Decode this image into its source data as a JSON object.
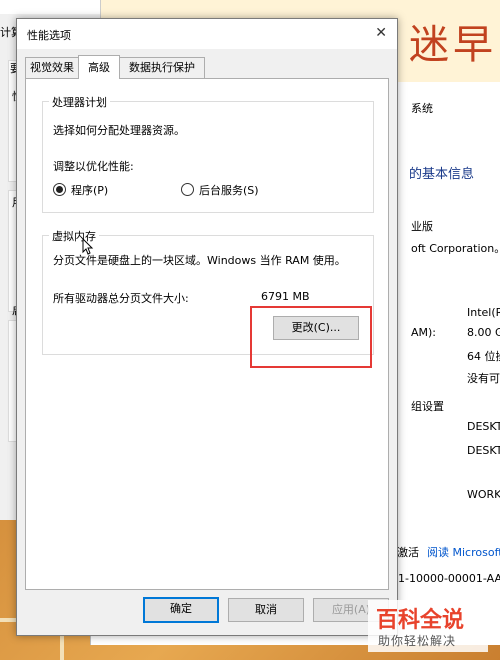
{
  "dialog": {
    "title": "性能选项",
    "tabs": [
      {
        "label": "视觉效果"
      },
      {
        "label": "高级"
      },
      {
        "label": "数据执行保护"
      }
    ],
    "processor_group": {
      "title": "处理器计划",
      "description": "选择如何分配处理器资源。",
      "adjust_label": "调整以优化性能:",
      "options": [
        {
          "label": "程序(P)",
          "selected": true
        },
        {
          "label": "后台服务(S)",
          "selected": false
        }
      ]
    },
    "vm_group": {
      "title": "虚拟内存",
      "description": "分页文件是硬盘上的一块区域。Windows 当作 RAM 使用。",
      "total_label": "所有驱动器总分页文件大小:",
      "total_value": "6791 MB",
      "change_button": "更改(C)..."
    },
    "buttons": {
      "ok": "确定",
      "cancel": "取消",
      "apply": "应用(A)"
    }
  },
  "background_left": {
    "title_fragment": "计算",
    "letters": [
      "要",
      "性",
      "用",
      "启"
    ]
  },
  "background_right": {
    "banner_text": "迷早",
    "lines": [
      "系统",
      "的基本信息",
      "业版",
      "oft Corporation。",
      "Intel(R",
      "AM):",
      "8.00 G",
      "64 位操",
      "没有可",
      "组设置",
      "DESKT",
      "DESKT",
      "WORK",
      "激活",
      "阅读 Microsoft",
      "31-10000-00001-AA"
    ]
  },
  "watermark": {
    "line1": "百科全说",
    "line2": "助你轻松解决"
  },
  "colors": {
    "highlight": "#e53935",
    "accent": "#0078d7",
    "link": "#0055cc"
  }
}
